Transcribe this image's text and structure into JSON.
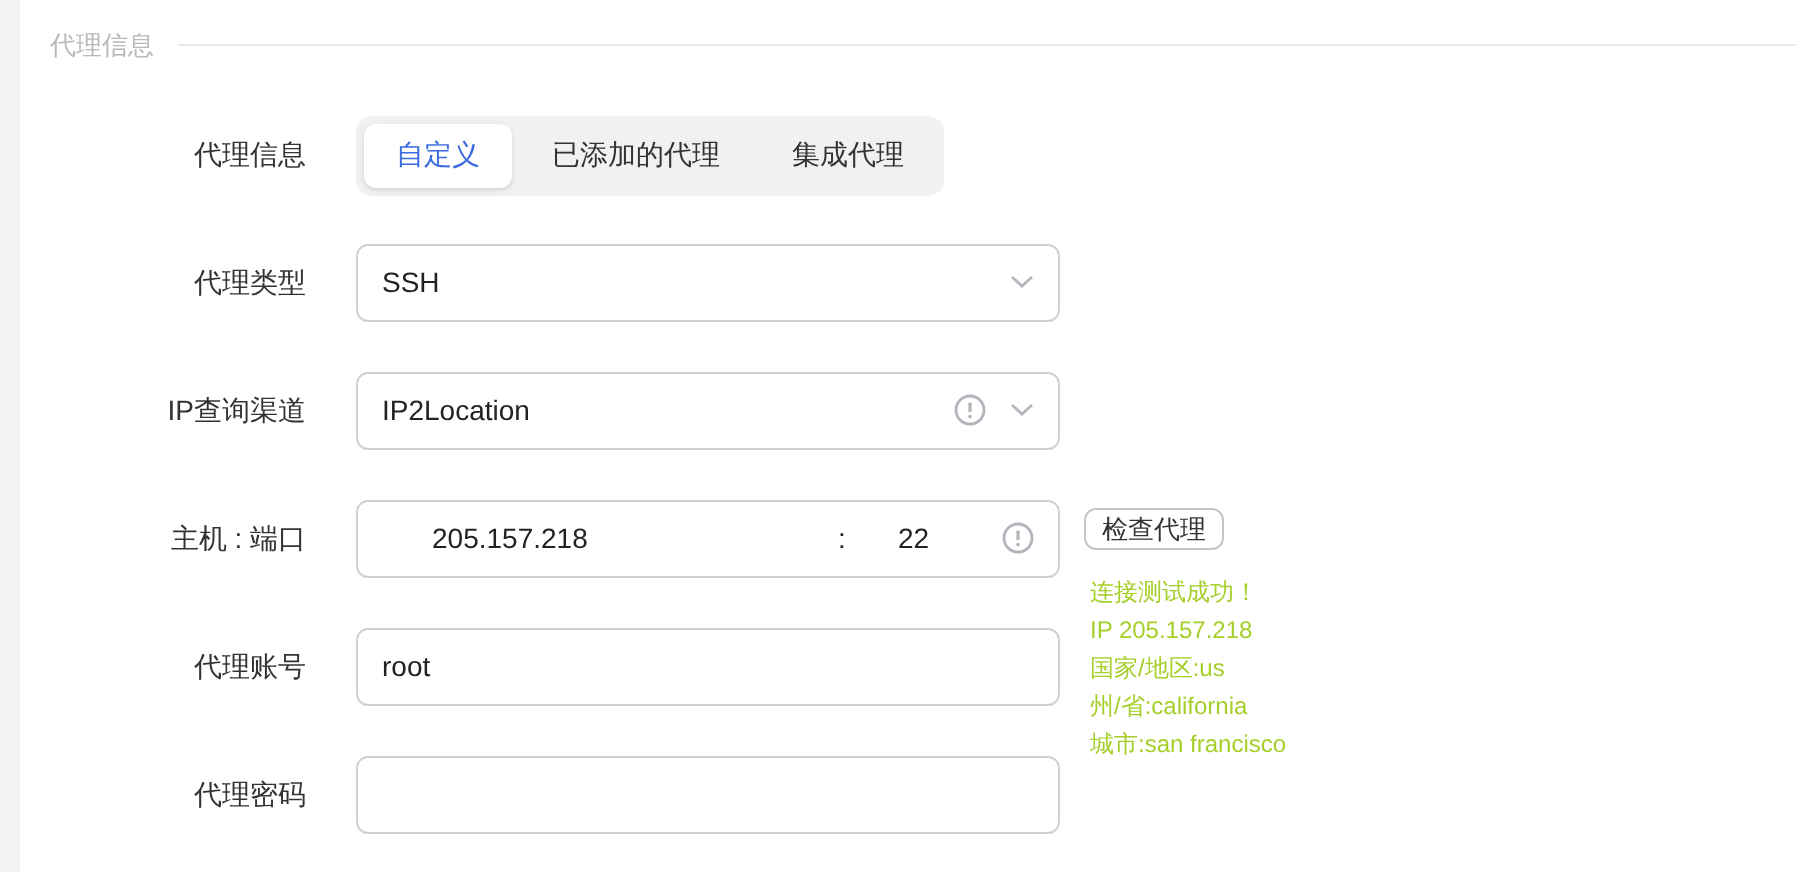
{
  "section_title": "代理信息",
  "proxy_source": {
    "label": "代理信息",
    "tabs": [
      {
        "label": "自定义",
        "selected": true
      },
      {
        "label": "已添加的代理",
        "selected": false
      },
      {
        "label": "集成代理",
        "selected": false
      }
    ]
  },
  "proxy_type": {
    "label": "代理类型",
    "value": "SSH"
  },
  "ip_channel": {
    "label": "IP查询渠道",
    "value": "IP2Location"
  },
  "host_port": {
    "label": "主机 : 端口",
    "host": "205.157.218",
    "separator": ":",
    "port": "22",
    "check_button": "检查代理"
  },
  "check_result": [
    "连接测试成功！",
    "IP 205.157.218",
    "国家/地区:us",
    "州/省:california",
    "城市:san francisco"
  ],
  "account": {
    "label": "代理账号",
    "value": "root"
  },
  "password": {
    "label": "代理密码"
  }
}
